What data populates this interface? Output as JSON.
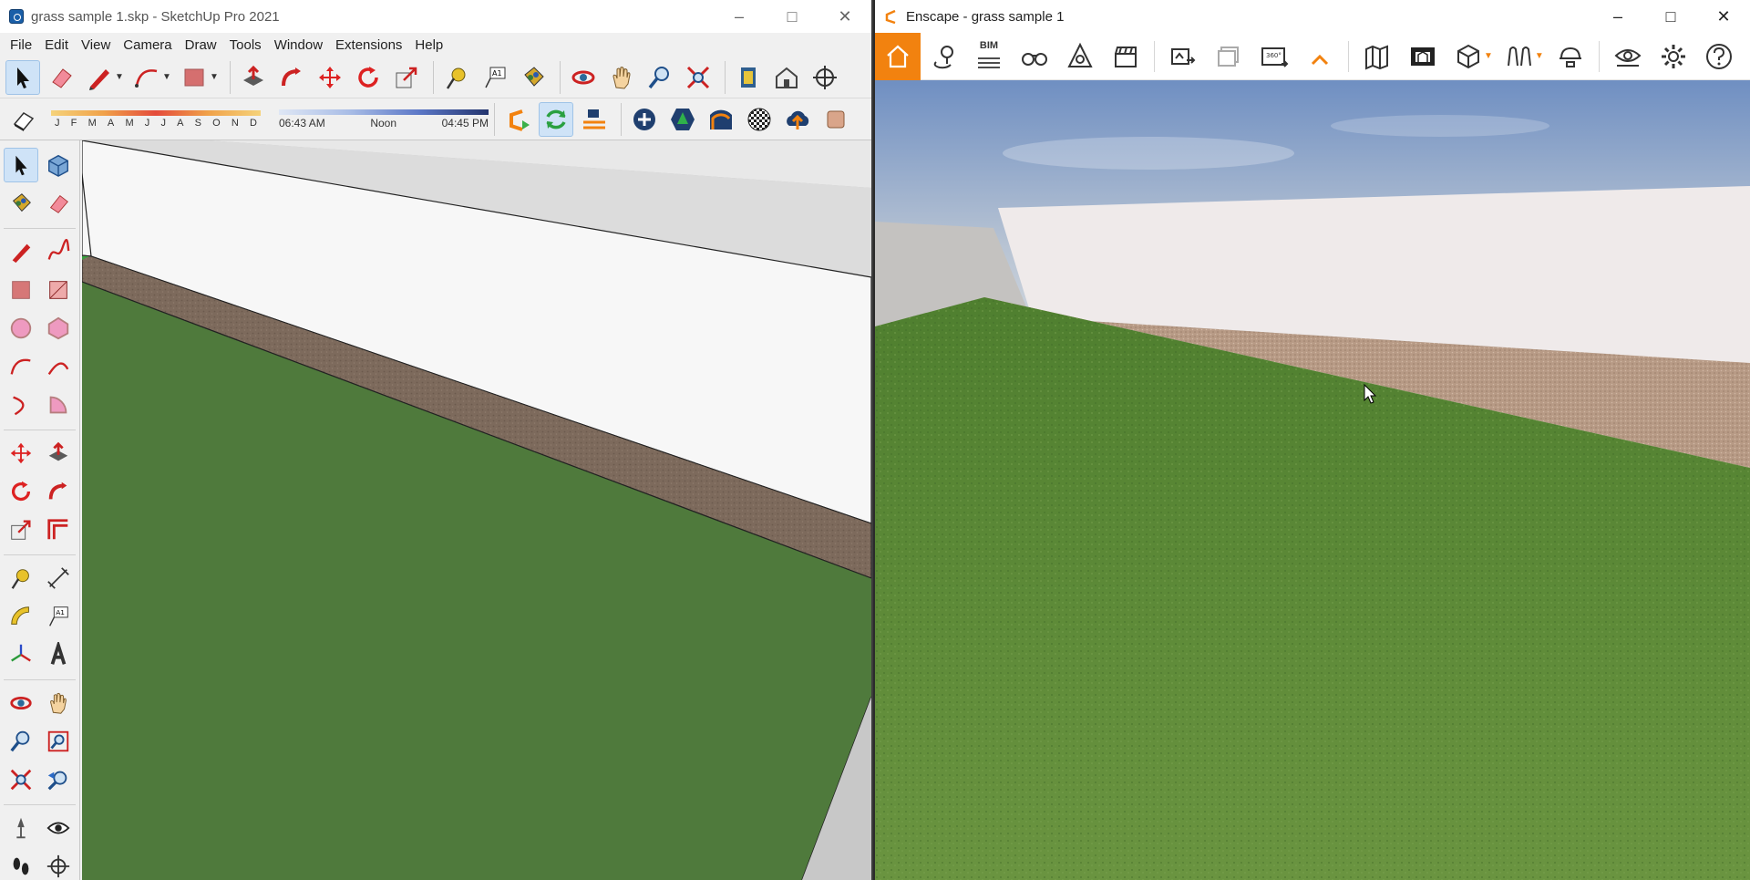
{
  "sketchup": {
    "title": "grass sample 1.skp - SketchUp Pro 2021",
    "menu": [
      "File",
      "Edit",
      "View",
      "Camera",
      "Draw",
      "Tools",
      "Window",
      "Extensions",
      "Help"
    ],
    "shadows": {
      "months": [
        "J",
        "F",
        "M",
        "A",
        "M",
        "J",
        "J",
        "A",
        "S",
        "O",
        "N",
        "D"
      ],
      "time_start": "06:43 AM",
      "time_mid": "Noon",
      "time_end": "04:45 PM"
    },
    "toolbar_row1_icons": [
      "select-icon",
      "eraser-icon",
      "pencil-icon",
      "circle-icon",
      "rectangle-icon",
      "push-pull-icon",
      "follow-me-icon",
      "move-icon",
      "rotate-icon",
      "scale-icon",
      "tape-measure-icon",
      "text-icon",
      "paint-bucket-icon",
      "orbit-icon",
      "pan-icon",
      "zoom-icon",
      "zoom-extents-icon",
      "warehouse-icon",
      "extension-warehouse-icon",
      "axes-icon"
    ],
    "toolbar_row2_icons": [
      "shadow-toggle-icon",
      "enscape-start-icon",
      "enscape-sync-icon",
      "enscape-views-icon",
      "enscape-add-icon",
      "enscape-asset-icon",
      "enscape-material-icon",
      "enscape-checker-icon",
      "enscape-upload-icon",
      "material-swatch-icon"
    ]
  },
  "enscape": {
    "title": "Enscape - grass sample 1",
    "bim_label": "BIM",
    "pano_label": "360°",
    "accent": "#f2820f"
  },
  "colors": {
    "grass_model": "#4f7a3c",
    "grass_render": "#5f8c3a",
    "wall": "#f7f7f7",
    "path": "#7d6a5c",
    "sky_top": "#6f8fc2",
    "sky_bottom": "#d7dbe0"
  }
}
